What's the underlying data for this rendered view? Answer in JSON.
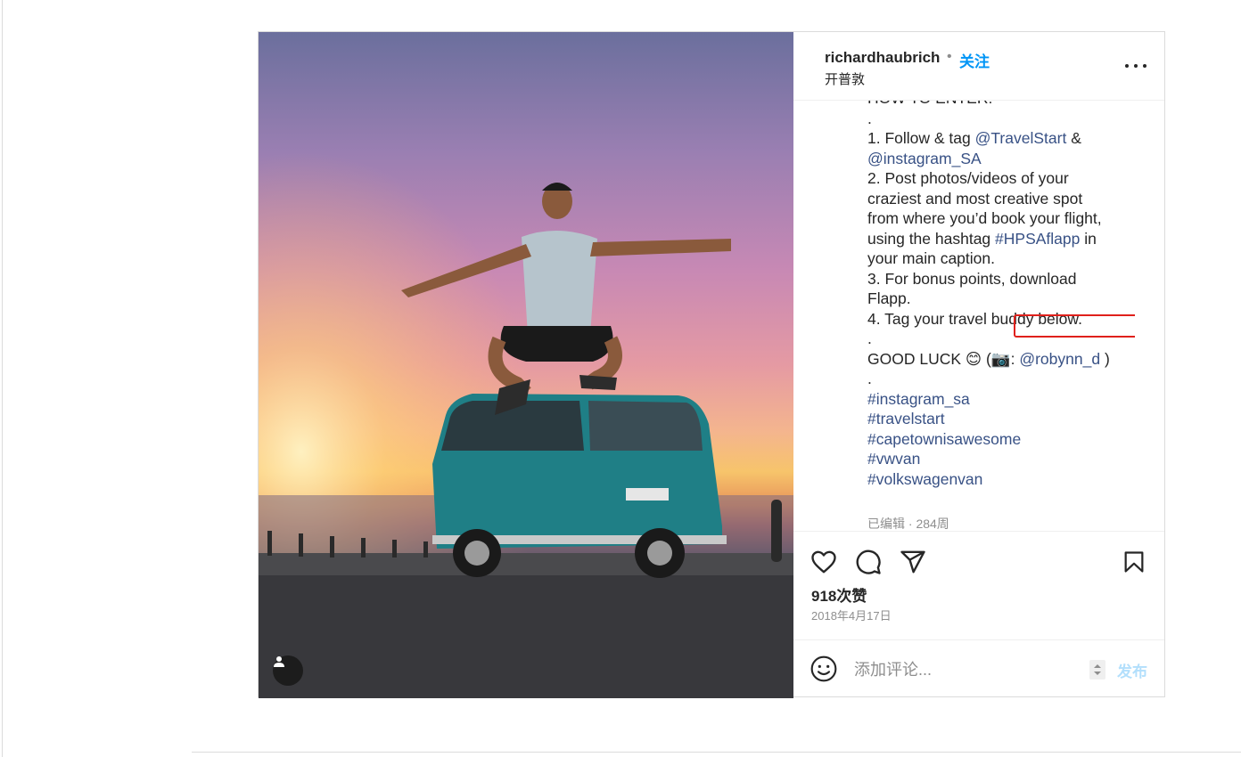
{
  "header": {
    "username": "richardhaubrich",
    "separator": "•",
    "follow_label": "关注",
    "location": "开普敦"
  },
  "caption": {
    "lines": [
      [
        {
          "t": "HOW TO ENTER:"
        }
      ],
      [
        {
          "t": "."
        }
      ],
      [
        {
          "t": "1. Follow & tag "
        },
        {
          "t": "@TravelStart",
          "link": true
        },
        {
          "t": " &"
        }
      ],
      [
        {
          "t": "@instagram_SA",
          "link": true
        }
      ],
      [
        {
          "t": "2. Post photos/videos of your"
        }
      ],
      [
        {
          "t": "craziest and most creative spot"
        }
      ],
      [
        {
          "t": "from where you’d book your flight,"
        }
      ],
      [
        {
          "t": "using the hashtag "
        },
        {
          "t": "#HPSAflapp",
          "link": true
        },
        {
          "t": " in"
        }
      ],
      [
        {
          "t": "your main caption."
        }
      ],
      [
        {
          "t": "3. For bonus points, download"
        }
      ],
      [
        {
          "t": "Flapp."
        }
      ],
      [
        {
          "t": "4. Tag your travel buddy below."
        }
      ],
      [
        {
          "t": "."
        }
      ],
      [
        {
          "t": "GOOD LUCK 😊 (📷: "
        },
        {
          "t": "@robynn_d",
          "link": true
        },
        {
          "t": " )"
        }
      ],
      [
        {
          "t": "."
        }
      ],
      [
        {
          "t": "#instagram_sa",
          "link": true
        }
      ],
      [
        {
          "t": "#travelstart",
          "link": true
        }
      ],
      [
        {
          "t": "#capetownisawesome",
          "link": true
        }
      ],
      [
        {
          "t": "#vwvan",
          "link": true
        }
      ],
      [
        {
          "t": "#volkswagenvan",
          "link": true
        }
      ]
    ],
    "edited": "已编辑 · 284周"
  },
  "actions": {
    "icons": [
      "heart-icon",
      "comment-icon",
      "share-icon",
      "bookmark-icon"
    ],
    "likes": "918次赞",
    "date": "2018年4月17日"
  },
  "comment": {
    "placeholder": "添加评论...",
    "post_label": "发布"
  },
  "colors": {
    "follow": "#0095f6",
    "link": "#385185",
    "highlight": "#e0201b",
    "post_disabled": "#b2dffc"
  }
}
